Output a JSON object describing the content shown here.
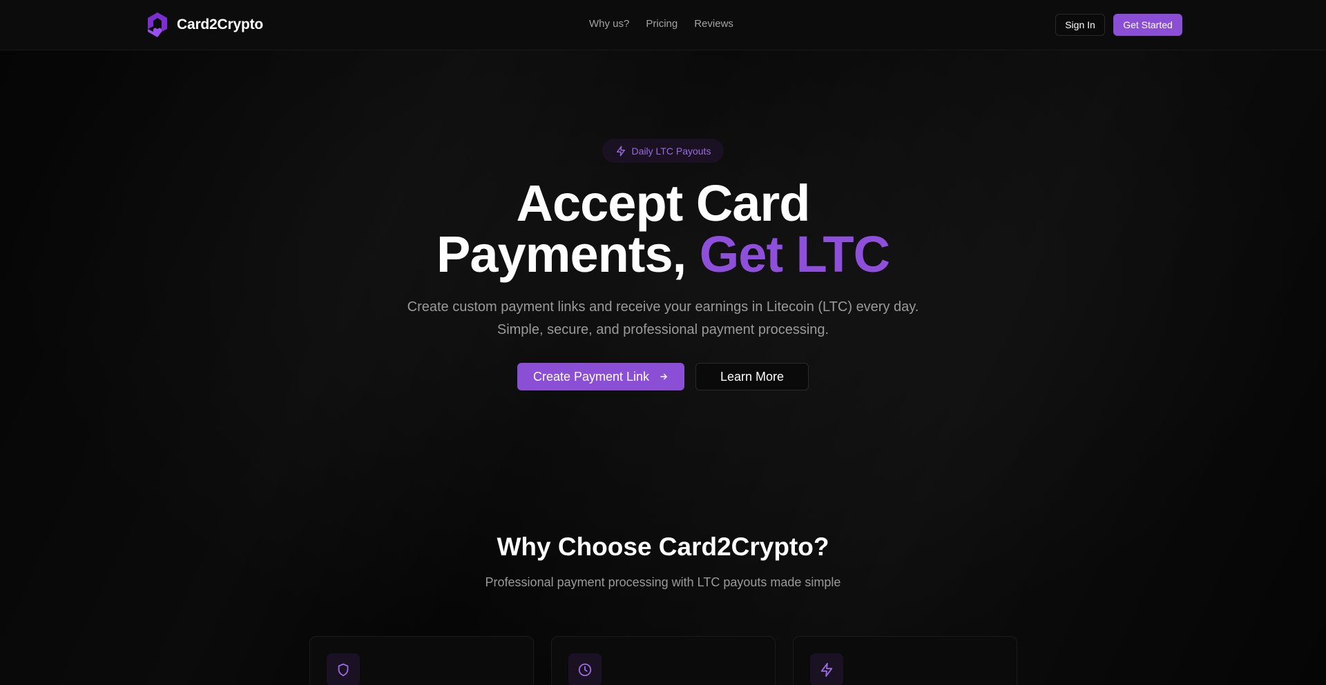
{
  "header": {
    "brand": "Card2Crypto",
    "nav": [
      {
        "label": "Why us?"
      },
      {
        "label": "Pricing"
      },
      {
        "label": "Reviews"
      }
    ],
    "sign_in": "Sign In",
    "get_started": "Get Started"
  },
  "hero": {
    "badge": "Daily LTC Payouts",
    "headline_line1": "Accept Card",
    "headline_line2_plain": "Payments, ",
    "headline_line2_accent": "Get LTC",
    "subtitle": "Create custom payment links and receive your earnings in Litecoin (LTC) every day. Simple, secure, and professional payment processing.",
    "primary_button": "Create Payment Link",
    "secondary_button": "Learn More"
  },
  "features": {
    "title": "Why Choose Card2Crypto?",
    "subtitle": "Professional payment processing with LTC payouts made simple",
    "cards": [
      {
        "icon": "shield-icon"
      },
      {
        "icon": "clock-icon"
      },
      {
        "icon": "lightning-icon"
      }
    ]
  },
  "colors": {
    "accent": "#8b4fd6",
    "accent_text": "#8e4fdb",
    "background": "#050505"
  }
}
